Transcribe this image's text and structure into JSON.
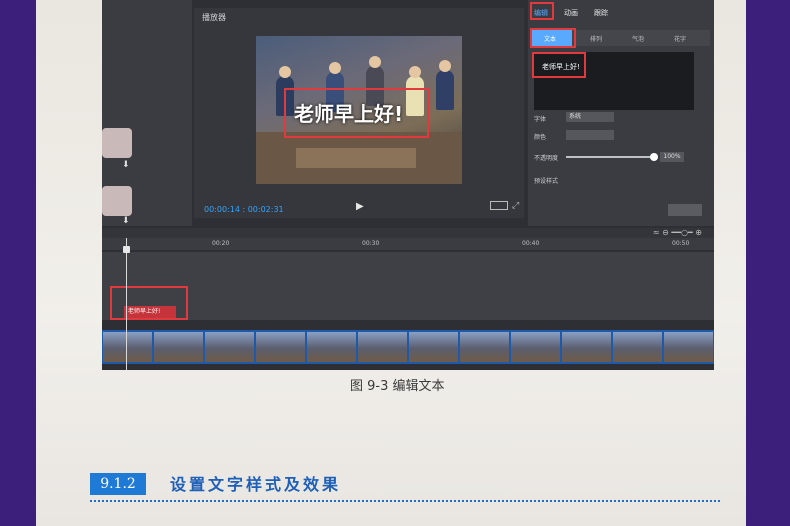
{
  "editor": {
    "preview_title": "播放器",
    "video_text": "老师早上好!",
    "time_readout": "00:00:14 : 00:02:31",
    "play_icon": "▶",
    "fit_icon": "⤢"
  },
  "right_panel": {
    "tabs": [
      "编辑",
      "动画",
      "跟踪"
    ],
    "subtabs": [
      "文本",
      "排列",
      "气泡",
      "花字"
    ],
    "text_value": "老师早上好!",
    "props": {
      "font_label": "字体",
      "font_value": "系统",
      "color_label": "颜色",
      "opacity_label": "不透明度",
      "opacity_value": "100%",
      "preset_label": "预设样式"
    }
  },
  "timeline": {
    "ticks": [
      "00:20",
      "00:30",
      "00:40",
      "00:50"
    ],
    "text_clip": "老师早上好!",
    "tools": "≈  ⊖ ━━○━ ⊕"
  },
  "caption": "图 9-3    编辑文本",
  "section": {
    "number": "9.1.2",
    "title": "设置文字样式及效果"
  },
  "colors": {
    "accent": "#1f7ad6",
    "highlight": "#e0393e",
    "time": "#33a4ff"
  }
}
